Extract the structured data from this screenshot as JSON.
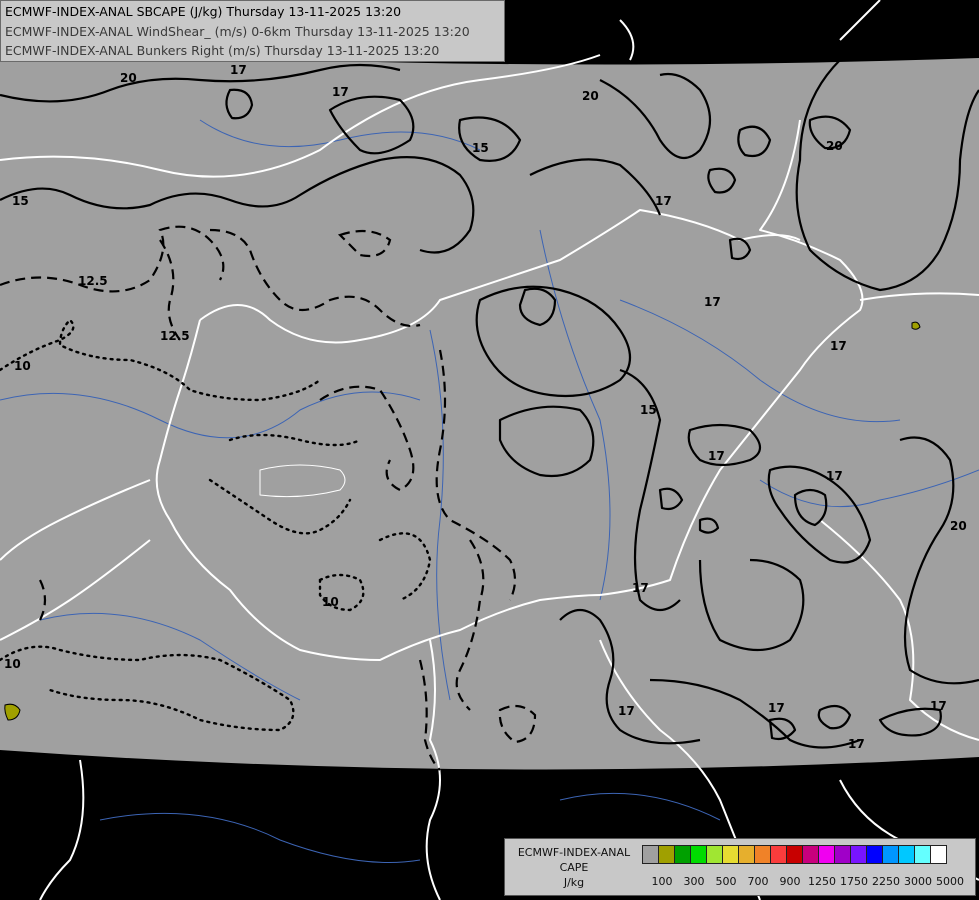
{
  "header": {
    "line1": "ECMWF-INDEX-ANAL SBCAPE (J/kg) Thursday 13-11-2025 13:20",
    "line2": "ECMWF-INDEX-ANAL WindShear_ (m/s) 0-6km Thursday 13-11-2025 13:20",
    "line3": "ECMWF-INDEX-ANAL Bunkers Right (m/s) Thursday 13-11-2025 13:20"
  },
  "legend": {
    "title_line1": "ECMWF-INDEX-ANAL",
    "title_line2": "CAPE",
    "title_line3": "J/kg",
    "colors": [
      "#a0a0a0",
      "#a0a000",
      "#00a000",
      "#00dc00",
      "#a0e632",
      "#e6dc32",
      "#e6af2d",
      "#f08228",
      "#fa3c3c",
      "#c80000",
      "#c8007d",
      "#f000f0",
      "#a000c8",
      "#7814ff",
      "#0000ff",
      "#0096ff",
      "#00c8ff",
      "#64ffff",
      "#ffffff"
    ],
    "ticks": [
      "100",
      "300",
      "500",
      "700",
      "900",
      "1250",
      "1750",
      "2250",
      "3000",
      "5000"
    ]
  },
  "contour_labels": [
    "20",
    "17",
    "17",
    "20",
    "15",
    "15",
    "17",
    "20",
    "12.5",
    "12.5",
    "10",
    "17",
    "15",
    "17",
    "17",
    "17",
    "20",
    "10",
    "10",
    "17",
    "17",
    "17",
    "17",
    "17"
  ],
  "colors": {
    "land": "#a0a0a0",
    "outside": "#000000",
    "borders": "#ffffff",
    "rivers": "#3c64b4",
    "contours": "#000000",
    "cape_low": "#a0a000"
  }
}
